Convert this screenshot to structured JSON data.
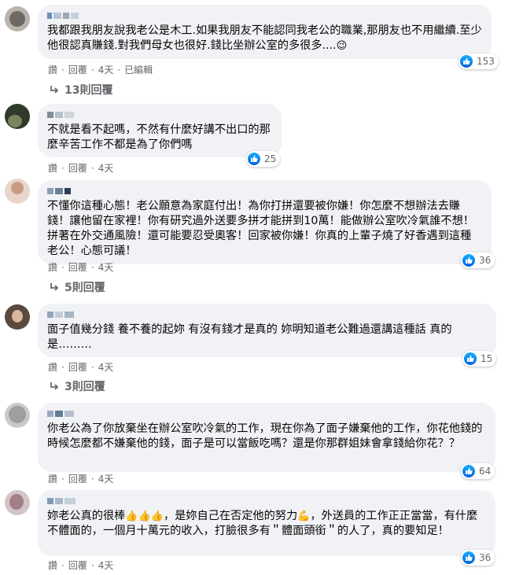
{
  "comments": [
    {
      "text": "我都跟我朋友說我老公是木工.如果我朋友不能認同我老公的職業,那朋友也不用繼續.至少他很認真賺錢.對我們母女也很好.錢比坐辦公室的多很多....",
      "emoji": "😉",
      "meta": [
        "讚",
        "回覆",
        "4天",
        "已編輯"
      ],
      "likes": "153",
      "replies": "13則回覆"
    },
    {
      "text": "不就是看不起嗎，不然有什麼好講不出口的那麼辛苦工作不都是為了你們嗎",
      "meta": [
        "讚",
        "回覆",
        "4天"
      ],
      "likes": "25"
    },
    {
      "text": "不懂你這種心態！老公願意為家庭付出！為你打拼還要被你嫌！你怎麼不想辦法去賺錢！讓他留在家裡！你有研究過外送要多拼才能拼到10萬！能做辦公室吹冷氣誰不想！拼著在外交通風險！還可能要忍受奧客！回家被你嫌！你真的上輩子燒了好香遇到這種老公！心態可議！",
      "meta": [
        "讚",
        "回覆",
        "4天"
      ],
      "likes": "36",
      "replies": "5則回覆"
    },
    {
      "text": "面子值幾分錢 養不養的起妳 有沒有錢才是真的 妳明知道老公難過還講這種話 真的是………",
      "meta": [
        "讚",
        "回覆",
        "4天"
      ],
      "likes": "15",
      "replies": "3則回覆"
    },
    {
      "text": "你老公為了你放棄坐在辦公室吹冷氣的工作，現在你為了面子嫌棄他的工作，你花他錢的時候怎麼都不嫌棄他的錢，面子是可以當飯吃嗎？還是你那群姐妹會拿錢給你花？？",
      "meta": [
        "讚",
        "回覆",
        "4天"
      ],
      "likes": "64"
    },
    {
      "text_a": "妳老公真的很棒",
      "emoji_a": "👍👍👍",
      "text_b": "，是妳自己在否定他的努力",
      "emoji_b": "💪",
      "text_c": "，外送員的工作正正當當，有什麼不體面的，一個月十萬元的收入，打臉很多有＂體面頭銜＂的人了，真的要知足！",
      "meta": [
        "讚",
        "回覆",
        "4天"
      ],
      "likes": "36"
    }
  ],
  "colors": {
    "bubble": "#f0f2f5",
    "meta_text": "#65676b",
    "like_blue": "#1877f2"
  },
  "icons": {
    "like": "thumbs-up-icon",
    "reply": "reply-arrow-icon"
  }
}
